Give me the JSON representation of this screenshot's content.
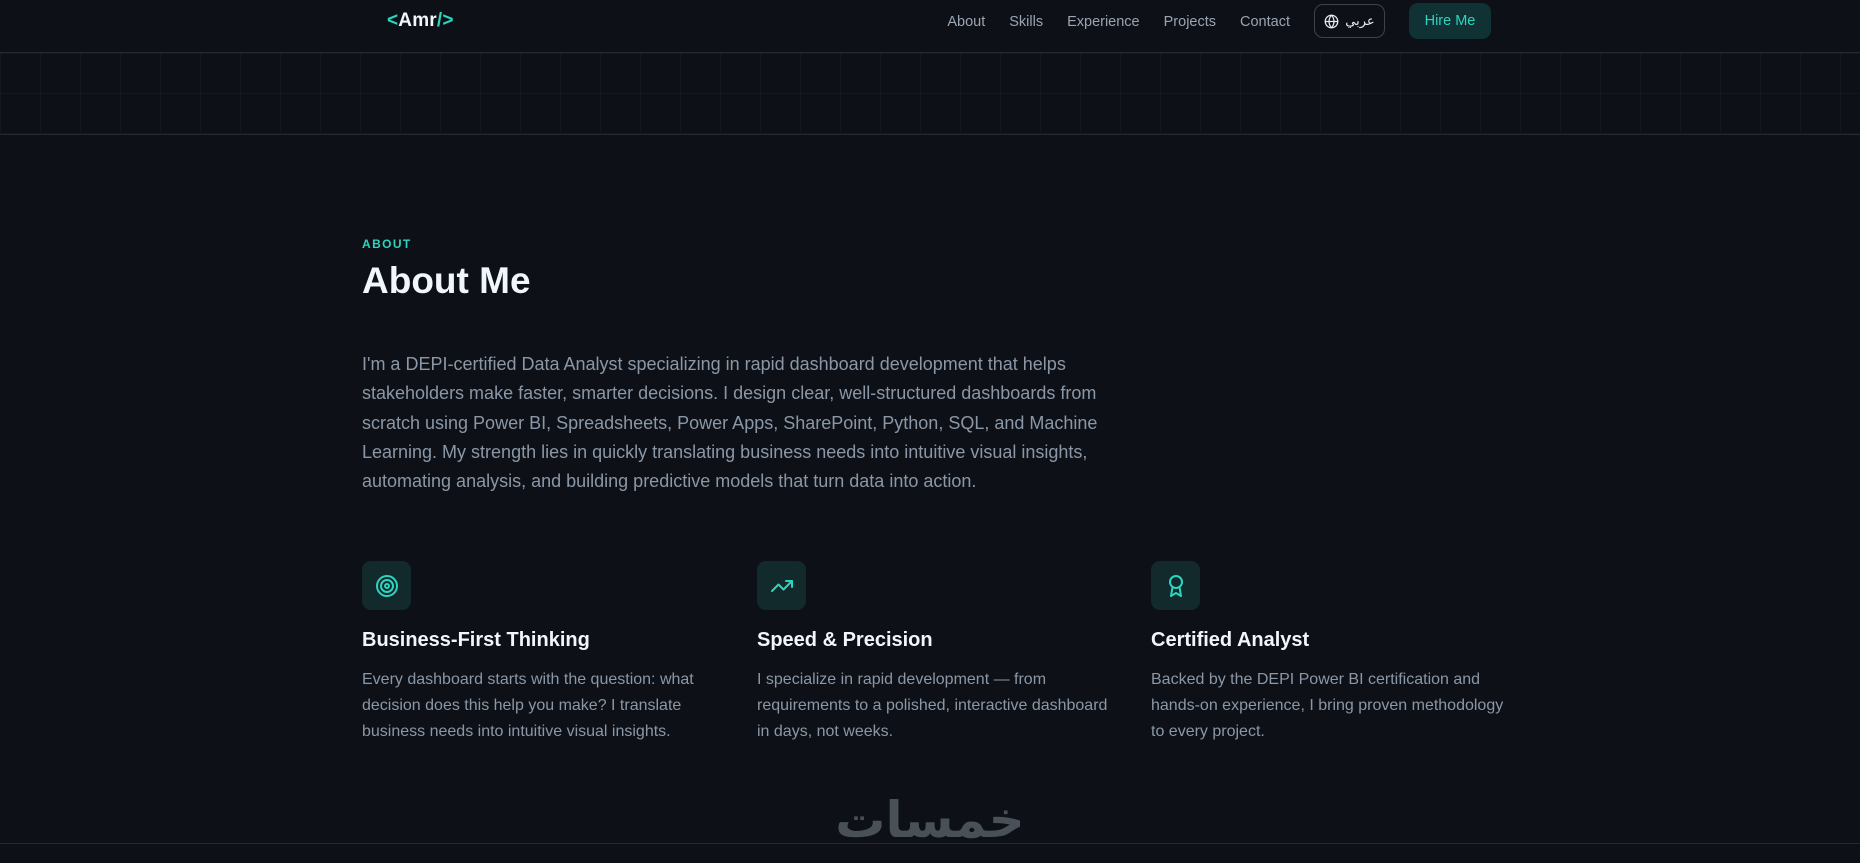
{
  "nav": {
    "logo_open": "<",
    "logo_text": "Amr",
    "logo_close": "/>",
    "links": [
      "About",
      "Skills",
      "Experience",
      "Projects",
      "Contact"
    ],
    "lang_label": "عربي",
    "lang_icon": "globe-icon",
    "hire_label": "Hire Me"
  },
  "about": {
    "eyebrow": "ABOUT",
    "title": "About Me",
    "paragraph": "I'm a DEPI-certified Data Analyst specializing in rapid dashboard development that helps stakeholders make faster, smarter decisions. I design clear, well-structured dashboards from scratch using Power BI, Spreadsheets, Power Apps, SharePoint, Python, SQL, and Machine Learning. My strength lies in quickly translating business needs into intuitive visual insights, automating analysis, and building predictive models that turn data into action."
  },
  "features": [
    {
      "icon": "target-icon",
      "title": "Business-First Thinking",
      "text": "Every dashboard starts with the question: what decision does this help you make? I translate business needs into intuitive visual insights."
    },
    {
      "icon": "trending-up-icon",
      "title": "Speed & Precision",
      "text": "I specialize in rapid development — from requirements to a polished, interactive dashboard in days, not weeks."
    },
    {
      "icon": "award-icon",
      "title": "Certified Analyst",
      "text": "Backed by the DEPI Power BI certification and hands-on experience, I bring proven methodology to every project."
    }
  ],
  "watermark": {
    "text": "خمسات"
  },
  "colors": {
    "background": "#0d1117",
    "accent": "#2dd4bf",
    "text_muted": "#8b97a6",
    "heading": "#f0f6fc"
  }
}
